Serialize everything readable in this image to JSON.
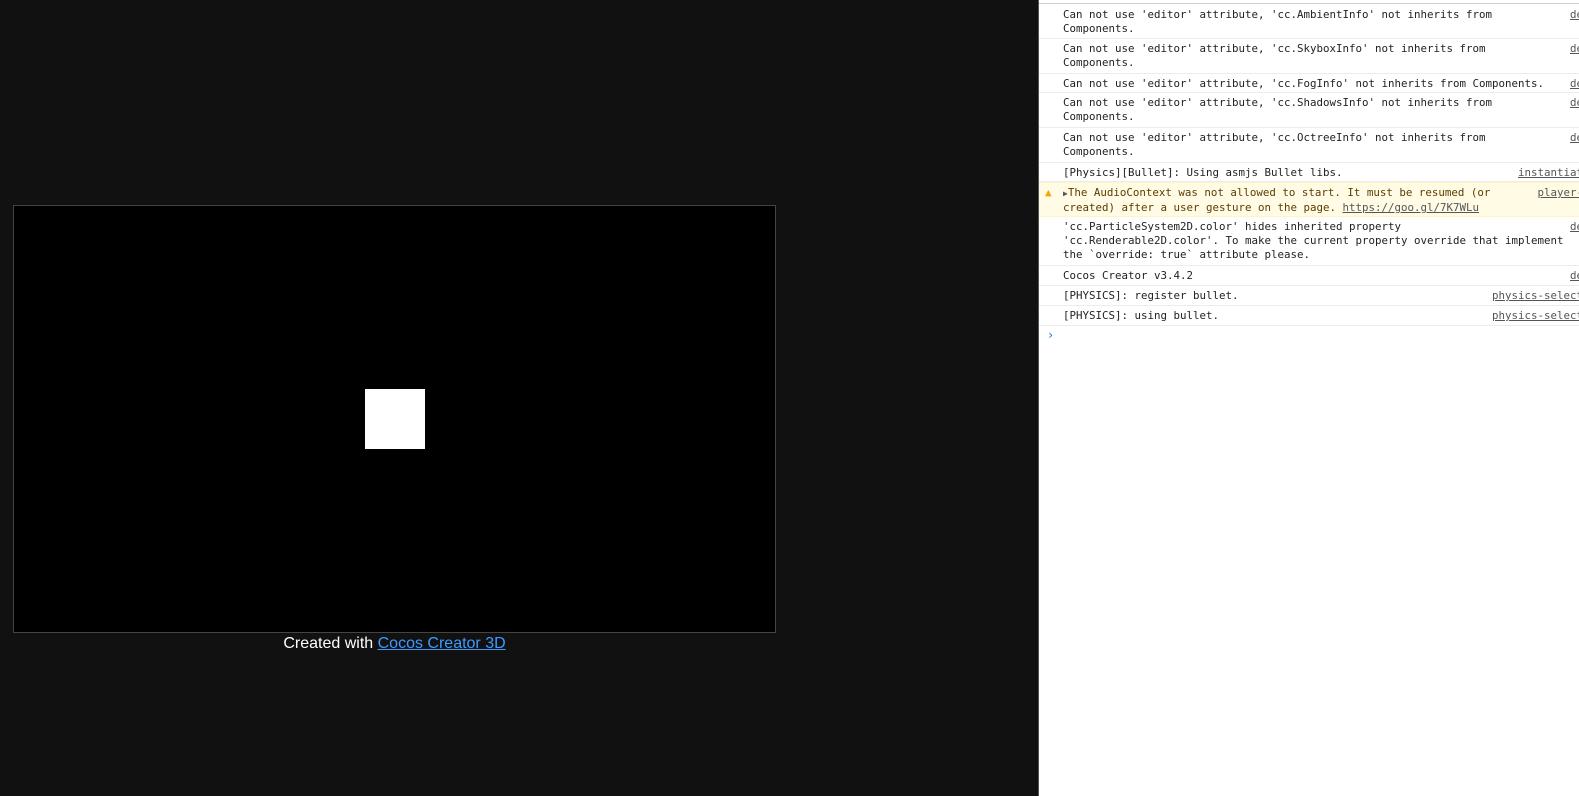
{
  "game": {
    "footer_prefix": "Created with ",
    "footer_link": "Cocos Creator 3D"
  },
  "console": {
    "messages": [
      {
        "lines": [
          "Can not use 'editor' attribute, 'cc.AmbientInfo' not inherits from",
          "Components."
        ],
        "source": "de"
      },
      {
        "lines": [
          "Can not use 'editor' attribute, 'cc.SkyboxInfo' not inherits from",
          "Components."
        ],
        "source": "de"
      },
      {
        "lines": [
          "Can not use 'editor' attribute, 'cc.FogInfo' not inherits from Components."
        ],
        "source": "de"
      },
      {
        "lines": [
          "Can not use 'editor' attribute, 'cc.ShadowsInfo' not inherits from",
          "Components."
        ],
        "source": "de"
      },
      {
        "lines": [
          "Can not use 'editor' attribute, 'cc.OctreeInfo' not inherits from",
          "Components."
        ],
        "source": "de"
      },
      {
        "lines": [
          "[Physics][Bullet]: Using asmjs Bullet libs."
        ],
        "source": "instantiat"
      },
      {
        "level": "warning",
        "lines": [
          "The AudioContext was not allowed to start. It must be resumed (or",
          "created) after a user gesture on the page. "
        ],
        "link": "https://goo.gl/7K7WLu",
        "source": "player-"
      },
      {
        "lines": [
          "'cc.ParticleSystem2D.color' hides inherited property",
          "'cc.Renderable2D.color'. To make the current property override that implement",
          "the `override: true` attribute please."
        ],
        "source": "de"
      },
      {
        "lines": [
          "Cocos Creator v3.4.2"
        ],
        "source": "de"
      },
      {
        "lines": [
          "[PHYSICS]: register bullet."
        ],
        "source": "physics-select"
      },
      {
        "lines": [
          "[PHYSICS]: using bullet."
        ],
        "source": "physics-select"
      }
    ],
    "prompt": "›"
  }
}
